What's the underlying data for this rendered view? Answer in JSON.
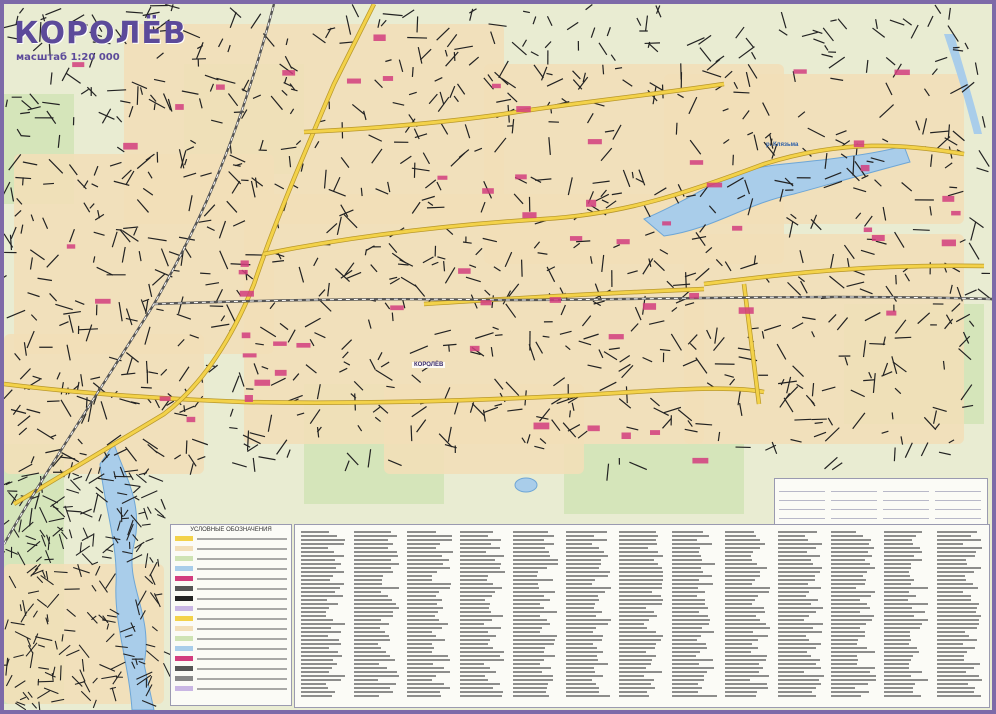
{
  "map": {
    "title": "КОРОЛЁВ",
    "scale": "масштаб 1:20 000"
  },
  "colors": {
    "border": "#7d6aa8",
    "background": "#e9ecd2",
    "urban": "#f2dfb8",
    "forest": "#cfe3b4",
    "water": "#a9cdea",
    "road_major": "#f3d24a",
    "road_minor": "#222222",
    "railway": "#555555",
    "landmark": "#d23d7e"
  },
  "labels": {
    "river": "р. Клязьма",
    "city_center": "КОРОЛЁВ"
  },
  "legend": {
    "title": "УСЛОВНЫЕ ОБОЗНАЧЕНИЯ"
  }
}
